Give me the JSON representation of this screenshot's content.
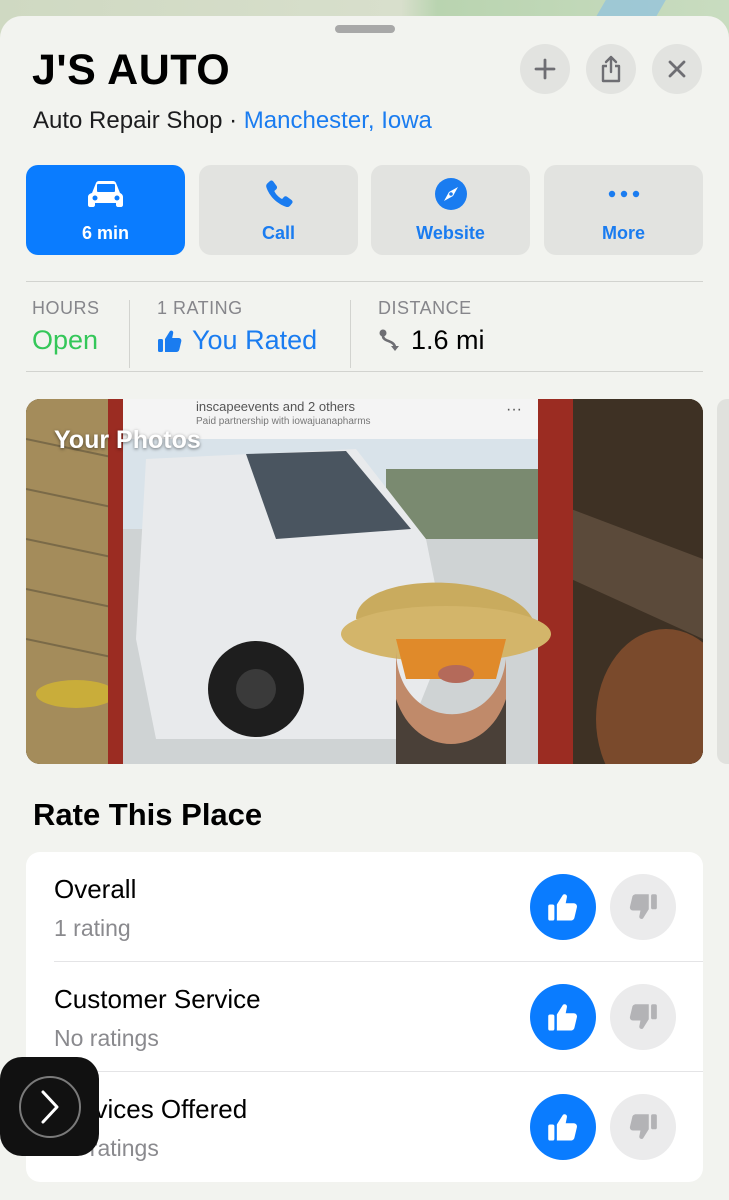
{
  "place": {
    "name": "J'S AUTO",
    "category": "Auto Repair Shop",
    "separator": " · ",
    "location": "Manchester, Iowa"
  },
  "header_buttons": [
    {
      "icon": "plus-icon"
    },
    {
      "icon": "share-icon"
    },
    {
      "icon": "close-icon"
    }
  ],
  "actions": [
    {
      "label": "6 min",
      "icon": "car-icon"
    },
    {
      "label": "Call",
      "icon": "phone-icon"
    },
    {
      "label": "Website",
      "icon": "compass-icon"
    },
    {
      "label": "More",
      "icon": "ellipsis-icon"
    }
  ],
  "info": {
    "hours": {
      "caption": "HOURS",
      "value": "Open",
      "color": "#34c759"
    },
    "rating": {
      "caption": "1 RATING",
      "value": "You Rated",
      "color": "#1a7cf0"
    },
    "distance": {
      "caption": "DISTANCE",
      "value": "1.6 mi"
    }
  },
  "photos": {
    "caption": "Your Photos",
    "overlay_account": "inscapeevents and 2 others",
    "overlay_sub": "Paid partnership with iowajuanapharms",
    "overlay_more": "···"
  },
  "rate_section": {
    "title": "Rate This Place",
    "rows": [
      {
        "name": "Overall",
        "sub": "1 rating"
      },
      {
        "name": "Customer Service",
        "sub": "No ratings"
      },
      {
        "name": "Services Offered",
        "sub": "No ratings"
      }
    ]
  },
  "colors": {
    "accent": "#0a7cff",
    "link": "#1a7cf0",
    "open": "#34c759"
  }
}
